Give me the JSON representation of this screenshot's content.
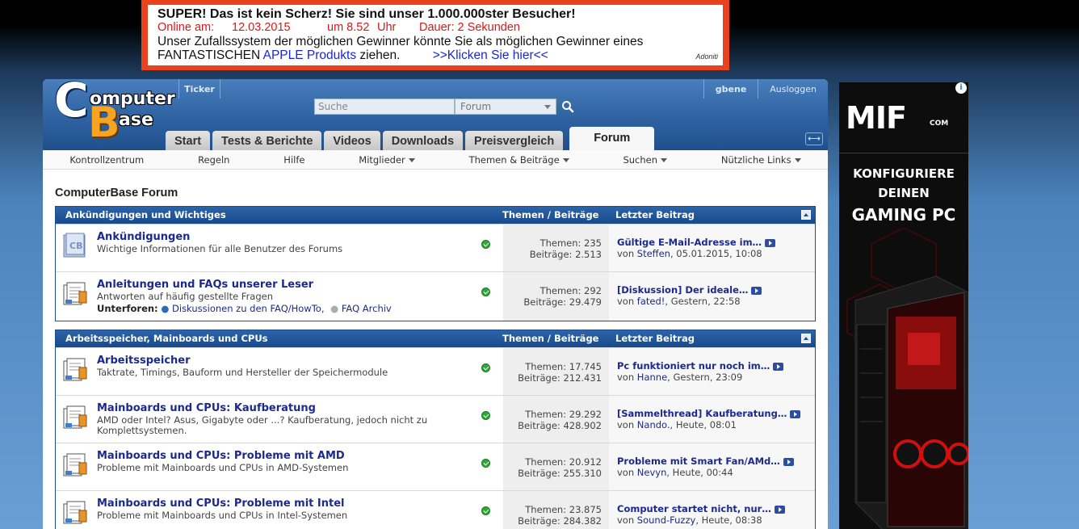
{
  "top_ad": {
    "line1": "SUPER! Das ist kein Scherz! Sie sind unser 1.000.000ster Besucher!",
    "online_label": "Online am:",
    "date": "12.03.2015",
    "time": "um 8.52",
    "uhr": "Uhr",
    "duration": "Dauer: 2 Sekunden",
    "line3": "Unser Zufallssystem der möglichen Gewinner könnte Sie als möglichen Gewinner eines",
    "line4_pre": "FANTASTISCHEN ",
    "line4_brand": "APPLE Produkts",
    "line4_post": " ziehen.",
    "cta": ">>Klicken Sie hier<<",
    "brand": "Adoniti"
  },
  "header": {
    "logo_word1": "omputer",
    "logo_word2": "ase",
    "logo_c": "C",
    "logo_b": "B",
    "ticker": "Ticker",
    "search_placeholder": "Suche",
    "search_scope": "Forum",
    "username": "gbene",
    "logout": "Ausloggen",
    "expand_glyph": "⟷"
  },
  "tabs": [
    "Start",
    "Tests & Berichte",
    "Videos",
    "Downloads",
    "Preisvergleich",
    "Forum"
  ],
  "subnav": [
    "Kontrollzentrum",
    "Regeln",
    "Hilfe",
    "Mitglieder",
    "Themen & Beiträge",
    "Suchen",
    "Nützliche Links"
  ],
  "page_title": "ComputerBase Forum",
  "categories": [
    {
      "name": "Ankündigungen und Wichtiges",
      "col_threads": "Themen / Beiträge",
      "col_last": "Letzter Beitrag",
      "forums": [
        {
          "title": "Ankündigungen",
          "desc": "Wichtige Informationen für alle Benutzer des Forums",
          "themes": "Themen: 235",
          "posts": "Beiträge: 2.513",
          "last_title": "Gültige E-Mail-Adresse im…",
          "last_by_pre": "von ",
          "last_user": "Steffen",
          "last_time": ", 05.01.2015, 10:08"
        },
        {
          "title": "Anleitungen und FAQs unserer Leser",
          "desc": "Antworten auf häufig gestellte Fragen",
          "sub_label": "Unterforen:",
          "sub1": "Diskussionen zu den FAQ/HowTo,",
          "sub2": "FAQ Archiv",
          "themes": "Themen: 292",
          "posts": "Beiträge: 29.479",
          "last_title": "[Diskussion] Der ideale…",
          "last_by_pre": "von ",
          "last_user": "fated!",
          "last_time": ", Gestern, 22:58"
        }
      ]
    },
    {
      "name": "Arbeitsspeicher, Mainboards und CPUs",
      "col_threads": "Themen / Beiträge",
      "col_last": "Letzter Beitrag",
      "forums": [
        {
          "title": "Arbeitsspeicher",
          "desc": "Taktrate, Timings, Bauform und Hersteller der Speichermodule",
          "themes": "Themen: 17.745",
          "posts": "Beiträge: 212.431",
          "last_title": "Pc funktioniert nur noch im…",
          "last_by_pre": "von ",
          "last_user": "Hanne",
          "last_time": ", Gestern, 23:09"
        },
        {
          "title": "Mainboards und CPUs: Kaufberatung",
          "desc": "AMD oder Intel? Asus, Gigabyte oder ...? Kaufberatung, jedoch nicht zu Komplettsystemen.",
          "themes": "Themen: 29.292",
          "posts": "Beiträge: 428.902",
          "last_title": "[Sammelthread] Kaufberatung…",
          "last_by_pre": "von ",
          "last_user": "Nando.",
          "last_time": ", Heute, 08:01"
        },
        {
          "title": "Mainboards und CPUs: Probleme mit AMD",
          "desc": "Probleme mit Mainboards und CPUs in AMD-Systemen",
          "themes": "Themen: 20.912",
          "posts": "Beiträge: 255.310",
          "last_title": "Probleme mit Smart Fan/AMd…",
          "last_by_pre": "von ",
          "last_user": "Nevyn",
          "last_time": ", Heute, 00:44"
        },
        {
          "title": "Mainboards und CPUs: Probleme mit Intel",
          "desc": "Probleme mit Mainboards und CPUs in Intel-Systemen",
          "themes": "Themen: 23.875",
          "posts": "Beiträge: 284.382",
          "last_title": "Computer startet nicht, nur…",
          "last_by_pre": "von ",
          "last_user": "Sound-Fuzzy",
          "last_time": ", Heute, 08:38"
        }
      ]
    }
  ],
  "side_ad": {
    "info": "i",
    "brand": "MIF",
    "brand_suffix": "COM",
    "line1": "KONFIGURIERE",
    "line2": "DEINEN",
    "line3": "GAMING PC"
  },
  "colors": {
    "header_blue": "#3569a8",
    "category_blue": "#1c4d8e",
    "link_blue": "#1b2a8c",
    "ad_red": "#e8431e",
    "status_green": "#2ea836"
  }
}
